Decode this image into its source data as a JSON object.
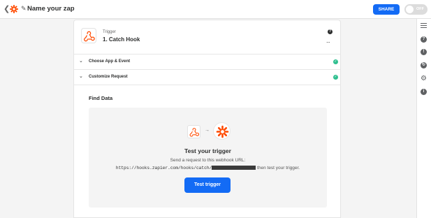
{
  "header": {
    "back_icon": "chevron-left-icon",
    "logo_icon": "zapier-logo",
    "edit_icon": "pencil-icon",
    "title": "Name your zap",
    "share_label": "SHARE",
    "toggle_label": "OFF",
    "accent": "#136bf5"
  },
  "step": {
    "label": "Trigger",
    "title": "1. Catch Hook",
    "app_icon": "webhooks-icon",
    "help_icon": "help-icon",
    "more_label": "..."
  },
  "sections": [
    {
      "label": "Choose App & Event",
      "status": "complete"
    },
    {
      "label": "Customize Request",
      "status": "complete"
    }
  ],
  "find_data": {
    "heading": "Find Data",
    "test_title": "Test your trigger",
    "send_text": "Send a request to this webhook URL:",
    "url": "https://hooks.zapier.com/hooks/catch/",
    "url_suffix": " then test your trigger.",
    "button_label": "Test trigger"
  },
  "right_sidebar": {
    "icons": [
      "notes-icon",
      "help-icon",
      "alert-icon",
      "history-icon",
      "gear-icon",
      "info-icon"
    ]
  },
  "status_color": "#2fbf8f"
}
